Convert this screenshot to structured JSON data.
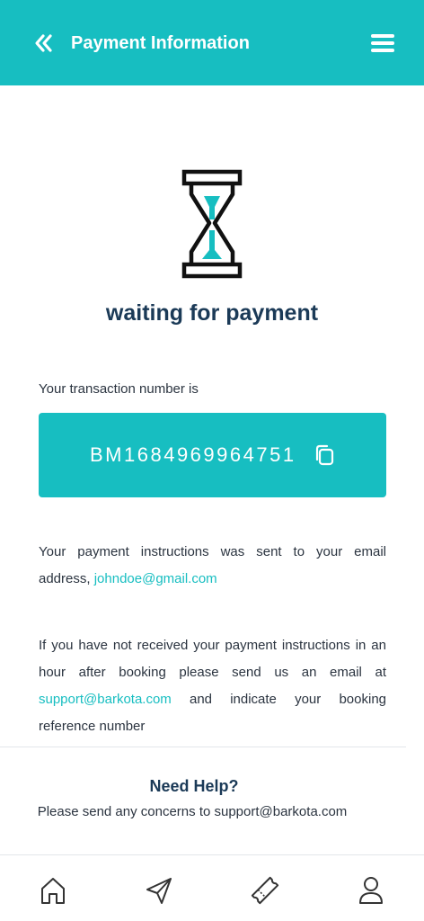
{
  "header": {
    "title": "Payment Information",
    "back_icon": "double-chevron-left-icon",
    "menu_icon": "hamburger-menu-icon"
  },
  "status": {
    "icon": "hourglass-icon",
    "title": "waiting for payment"
  },
  "transaction": {
    "label": "Your transaction number is",
    "number": "BM1684969964751",
    "copy_icon": "copy-icon"
  },
  "instructions": {
    "sent_text": "Your payment instructions was sent to your email address, ",
    "email": "johndoe@gmail.com",
    "not_received_text": "If you have not received your payment instructions in an hour after booking please send us an email at ",
    "support_email": "support@barkota.com",
    "not_received_suffix": " and indicate your booking reference number"
  },
  "help": {
    "title": "Need Help?",
    "text": "Please send any concerns to support@barkota.com"
  },
  "bottom_nav": {
    "items": [
      {
        "icon": "home-icon"
      },
      {
        "icon": "send-icon"
      },
      {
        "icon": "ticket-icon"
      },
      {
        "icon": "profile-icon"
      }
    ]
  },
  "colors": {
    "accent": "#17bec1",
    "heading": "#1b3a57",
    "text": "#2b3440"
  }
}
